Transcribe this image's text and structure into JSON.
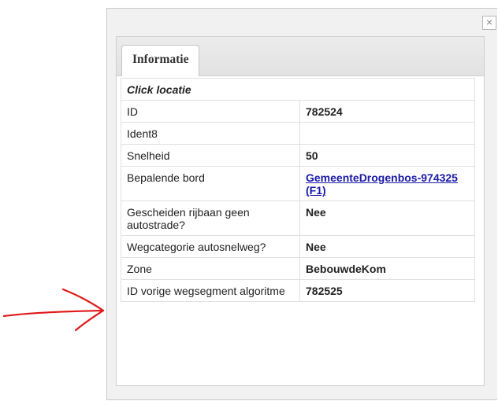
{
  "popup": {
    "close_label": "×",
    "tab_label": "Informatie",
    "section_title": "Click locatie",
    "rows": [
      {
        "label": "ID",
        "value": "782524"
      },
      {
        "label": "Ident8",
        "value": ""
      },
      {
        "label": "Snelheid",
        "value": "50"
      },
      {
        "label": "Bepalende bord",
        "value": "GemeenteDrogenbos-974325 (F1)",
        "link": true
      },
      {
        "label": "Gescheiden rijbaan geen autostrade?",
        "value": "Nee"
      },
      {
        "label": "Wegcategorie autosnelweg?",
        "value": "Nee"
      },
      {
        "label": "Zone",
        "value": "BebouwdeKom"
      },
      {
        "label": "ID vorige wegsegment algoritme",
        "value": "782525"
      }
    ]
  },
  "annotation": {
    "arrow_color": "#e01818",
    "icon": "red-hand-drawn-arrow"
  }
}
